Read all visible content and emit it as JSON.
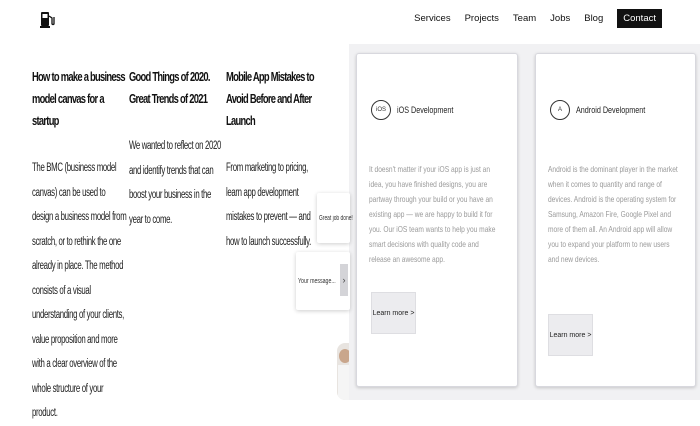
{
  "header": {
    "logo_icon": "fuel-pump-icon",
    "nav": [
      "Services",
      "Projects",
      "Team",
      "Jobs",
      "Blog"
    ],
    "contact_label": "Contact"
  },
  "blog": {
    "posts": [
      {
        "title": "How to make a business model canvas for a startup",
        "excerpt": "The BMC (business model canvas) can be used to design a business model from scratch, or to rethink the one already in place. The method consists of a visual understanding of your clients, value proposition and more with a clear overview of the whole structure of your product."
      },
      {
        "title": "Good Things of 2020. Great Trends of 2021",
        "excerpt": "We wanted to reflect on 2020 and identify trends that can boost your business in the year to come."
      },
      {
        "title": "Mobile App Mistakes to Avoid Before and After Launch",
        "excerpt": "From marketing to pricing, learn app development mistakes to prevent — and how to launch successfully."
      }
    ]
  },
  "services": [
    {
      "icon_label": "iOS",
      "title": "iOS Development",
      "text": "It doesn't matter if your iOS app is just an idea, you have finished designs, you are partway through your build or you have an existing app — we are happy to build it for you. Our iOS team wants to help you make smart decisions with quality code and release an awesome app.",
      "button": "Learn more >"
    },
    {
      "icon_label": "A",
      "title": "Android Development",
      "text": "Android is the dominant player in the market when it comes to quantity and range of devices. Android is the operating system for Samsung, Amazon Fire, Google Pixel and more of them all. An Android app will allow you to expand your platform to new users and new devices.",
      "button": "Learn more >"
    }
  ],
  "floating": {
    "first": "Great job done! ",
    "second": "Your message..."
  }
}
